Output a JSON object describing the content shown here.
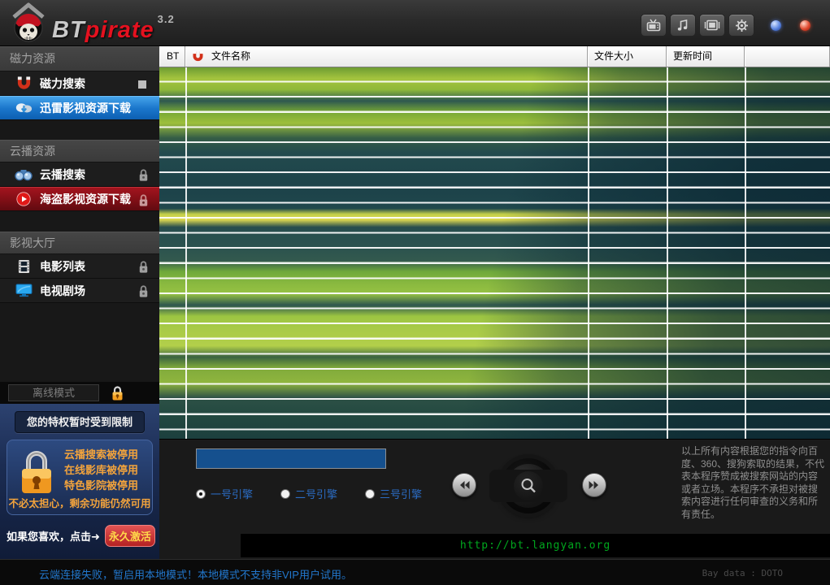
{
  "brand": {
    "bt": "BT",
    "pirate": "pirate",
    "version": "3.2"
  },
  "toolbar": {
    "icons": [
      "tv-icon",
      "music-icon",
      "film-icon",
      "settings-icon"
    ]
  },
  "window_controls": {
    "minimize": "blue-orb-button",
    "close": "red-orb-button"
  },
  "sidebar": {
    "sections": [
      {
        "label": "磁力资源",
        "items": [
          {
            "label": "磁力搜索",
            "icon": "magnet-icon",
            "badge": "square"
          },
          {
            "label": "迅雷影视资源下载",
            "icon": "cloud-download-icon",
            "state": "active-blue"
          }
        ]
      },
      {
        "label": "云播资源",
        "items": [
          {
            "label": "云播搜索",
            "icon": "binoculars-icon",
            "badge": "lock"
          },
          {
            "label": "海盗影视资源下载",
            "icon": "play-icon",
            "state": "active-red",
            "badge": "lock"
          }
        ]
      },
      {
        "label": "影视大厅",
        "items": [
          {
            "label": "电影列表",
            "icon": "film-list-icon",
            "badge": "lock"
          },
          {
            "label": "电视剧场",
            "icon": "tv-screen-icon",
            "badge": "lock"
          }
        ]
      }
    ],
    "offline_mode_label": "离线模式",
    "privilege_notice": "您的特权暂时受到限制",
    "restrictions": [
      "云播搜索被停用",
      "在线影库被停用",
      "特色影院被停用"
    ],
    "reassurance": "不必太担心，剩余功能仍然可用",
    "like_prompt": "如果您喜欢，点击➜",
    "activate_button": "永久激活"
  },
  "table": {
    "columns": [
      "BT",
      "文件名称",
      "文件大小",
      "更新时间"
    ]
  },
  "search": {
    "value": "",
    "engines": [
      "一号引擎",
      "二号引擎",
      "三号引擎"
    ],
    "selected_engine": "一号引擎"
  },
  "disclaimer": "以上所有内容根据您的指令向百度、360、搜狗索取的结果，不代表本程序赞成被搜索网站的内容或者立场。本程序不承担对被搜索内容进行任何审查的义务和所有责任。",
  "footer": {
    "site_url": "http://bt.langyan.org",
    "status_message": "云端连接失败，暂启用本地模式！本地模式不支持非VIP用户试用。",
    "bay_data": "Bay data : DOTO"
  },
  "colors": {
    "active_item_blue": "#1b77cc",
    "active_item_red": "#8e1318",
    "warning_orange": "#f2a33c",
    "activate_red": "#c23030",
    "url_green": "#00a61e",
    "status_text_blue": "#2277cc",
    "search_field_blue": "#15508e"
  }
}
